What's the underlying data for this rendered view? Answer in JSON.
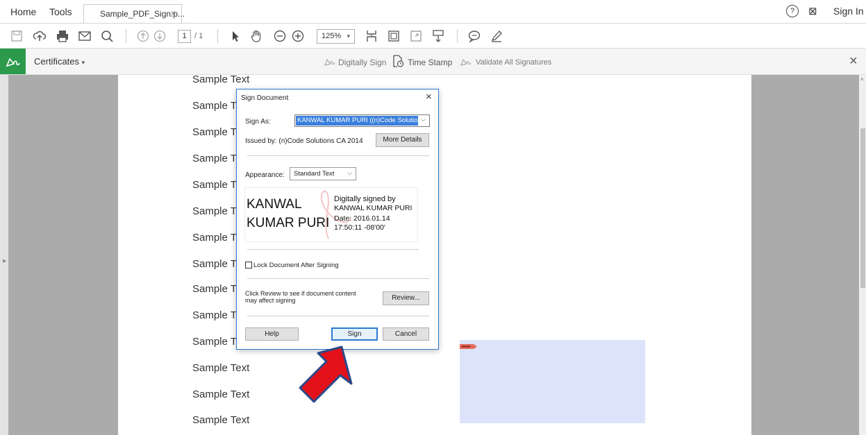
{
  "tabbar": {
    "home": "Home",
    "tools": "Tools",
    "doc_tab": "Sample_PDF_Sign.p...",
    "doc_tab_close": "×",
    "help_icon": "?",
    "phone_icon": "⊠",
    "sign_in": "Sign In"
  },
  "toolbar": {
    "page_current": "1",
    "page_total": "/ 1",
    "zoom": "125%",
    "icons": [
      "save-icon",
      "upload-icon",
      "print-icon",
      "email-icon",
      "search-icon",
      "prev-page-icon",
      "next-page-icon",
      "select-cursor-icon",
      "hand-icon",
      "zoom-out-icon",
      "zoom-in-icon",
      "fit-page-icon",
      "page-view-icon",
      "fullscreen-icon",
      "scroll-mode-icon",
      "comment-icon",
      "pen-icon"
    ]
  },
  "certbar": {
    "title": "Certificates",
    "digitally_sign": "Digitally Sign",
    "time_stamp": "Time Stamp",
    "validate": "Validate All Signatures",
    "close": "×"
  },
  "document": {
    "sample_lines": [
      "Sample Text",
      "Sample T",
      "Sample T",
      "Sample T",
      "Sample T",
      "Sample T",
      "Sample T",
      "Sample T",
      "Sample T",
      "Sample T",
      "Sample T",
      "Sample Text",
      "Sample Text",
      "Sample Text"
    ]
  },
  "dialog": {
    "title": "Sign Document",
    "close": "×",
    "sign_as_label": "Sign As:",
    "sign_as_value": "KANWAL KUMAR PURI ((n)Code Solutions",
    "issued_by": "Issued by: (n)Code Solutions CA 2014",
    "more_details": "More Details",
    "appearance_label": "Appearance:",
    "appearance_value": "Standard Text",
    "preview_name_line1": "KANWAL",
    "preview_name_line2": "KUMAR PURI",
    "preview_detail_1": "Digitally signed by",
    "preview_detail_2": "KANWAL KUMAR PURI",
    "preview_detail_3": "Date: 2016.01.14",
    "preview_detail_4": "17:50:11 -08'00'",
    "lock_label": "Lock Document After Signing",
    "review_text_1": "Click Review to see if document content",
    "review_text_2": "may affect signing",
    "review_button": "Review...",
    "help_button": "Help",
    "sign_button": "Sign",
    "cancel_button": "Cancel"
  },
  "colors": {
    "accent_green": "#2d9a4b",
    "dialog_border": "#2b7bd0",
    "selection_blue": "#3a7fdc",
    "arrow_red": "#e3121a",
    "arrow_outline": "#2a4a8a"
  }
}
